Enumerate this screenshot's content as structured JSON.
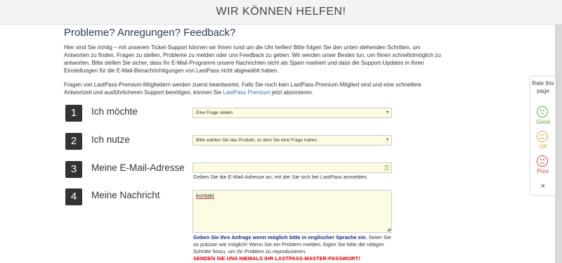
{
  "header": {
    "title": "WIR KÖNNEN HELFEN!"
  },
  "main": {
    "headline": "Probleme? Anregungen? Feedback?",
    "intro": "Hier sind Sie richtig – mit unserem Ticket-Support können wir Ihnen rund um die Uhr helfen! Bitte folgen Sie den unten stehenden Schritten, um Antworten zu finden, Fragen zu stellen, Probleme zu melden oder uns Feedback zu geben. Wir werden unser Bestes tun, um Ihnen schnellstmöglich zu antworten. Bitte stellen Sie sicher, dass Ihr E-Mail-Programm unsere Nachrichten nicht als Spam markiert und dass die Support-Updates in Ihren Einstellungen für die E-Mail-Benachrichtigungen von LastPass nicht abgewählt haben.",
    "premium_text_before": "Fragen von LastPass-Premium-Mitgliedern werden zuerst beantwortet. Falls Sie noch kein LastPass-Premium-Mitglied sind und eine schnellere Antwortzeit und ausführlicheren Support benötigen, können Sie ",
    "premium_link": "LastPass Premium",
    "premium_text_after": " jetzt abonnieren."
  },
  "steps": [
    {
      "number": "1",
      "label": "Ich möchte",
      "select_value": "Eine Frage stellen"
    },
    {
      "number": "2",
      "label": "Ich nutze",
      "select_value": "Bitte wählen Sie das Produkt, zu dem Sie eine Frage haben."
    },
    {
      "number": "3",
      "label": "Meine E-Mail-Adresse",
      "input_value": "",
      "help": "Geben Sie die E-Mail-Adresse an, mit der Sie sich bei LastPass anmelden."
    },
    {
      "number": "4",
      "label": "Meine Nachricht",
      "textarea_value": "kontakt"
    }
  ],
  "message_note": {
    "bold_blue": "Geben Sie Ihre Anfrage wenn möglich bitte in englischer Sprache ein.",
    "text": " Seien Sie so präzise wie möglich! Wenn Sie ein Problem melden, fügen Sie bitte die nötigen Schritte hinzu, um Ihr Problem zu reproduzieren.",
    "warning": "SENDEN SIE UNS NIEMALS IHR LASTPASS-MASTER-PASSWORT!"
  },
  "rating": {
    "title": "Rate this page",
    "good": "Good",
    "ok": "OK",
    "poor": "Poor",
    "close": "×",
    "colors": {
      "good": "#5aab3c",
      "ok": "#e8a23a",
      "poor": "#d9443a"
    }
  },
  "icons": {
    "caret": "▾",
    "key": "⚿",
    "resize": "◢"
  }
}
